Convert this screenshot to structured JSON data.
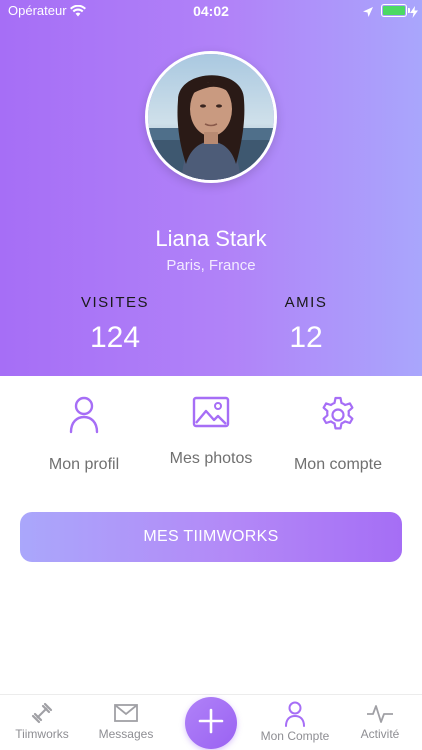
{
  "status_bar": {
    "carrier": "Opérateur",
    "time": "04:02"
  },
  "colors": {
    "accent": "#a66ef6",
    "gradient_light": "#aaa7fb",
    "battery": "#4cd964"
  },
  "profile": {
    "name": "Liana Stark",
    "location": "Paris, France",
    "stats": [
      {
        "label": "VISITES",
        "value": "124"
      },
      {
        "label": "AMIS",
        "value": "12"
      }
    ]
  },
  "actions": [
    {
      "label": "Mon profil",
      "icon": "user-icon"
    },
    {
      "label": "Mes photos",
      "icon": "image-icon"
    },
    {
      "label": "Mon compte",
      "icon": "gear-icon"
    }
  ],
  "cta": {
    "label": "MES TIIMWORKS"
  },
  "tabs": [
    {
      "label": "Tiimworks",
      "icon": "dumbbell-icon"
    },
    {
      "label": "Messages",
      "icon": "envelope-icon"
    },
    {
      "label": "Mon Compte",
      "icon": "user-icon",
      "active": true
    },
    {
      "label": "Activité",
      "icon": "pulse-icon"
    }
  ]
}
